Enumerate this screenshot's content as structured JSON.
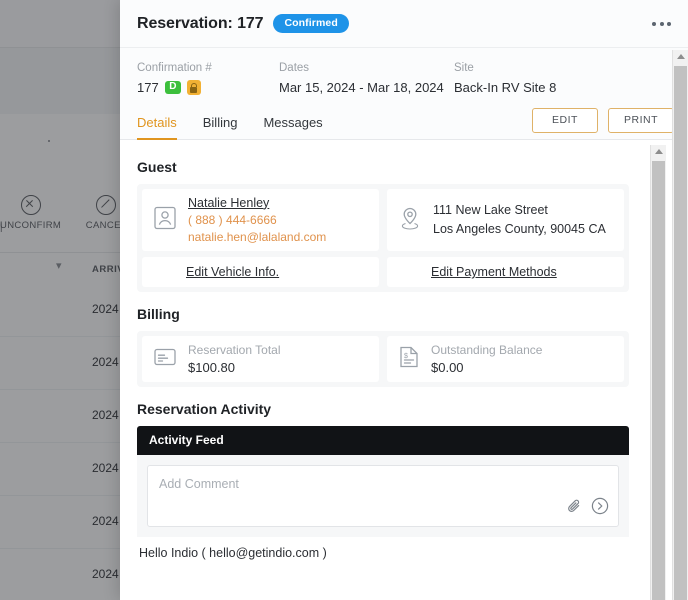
{
  "background": {
    "actions": [
      {
        "label": "UNCONFIRM",
        "icon": "circle-x-icon"
      },
      {
        "label": "CANCEL",
        "icon": "circle-slash-icon"
      }
    ],
    "table": {
      "sort_icon": "sort-icon",
      "column_header": "ARRIV",
      "rows": [
        "2024",
        "2024",
        "2024",
        "2024",
        "2024",
        "2024"
      ]
    }
  },
  "modal": {
    "title": "Reservation: 177",
    "status": "Confirmed",
    "status_color": "#1e93e8",
    "kebab": "more-options-icon",
    "summary": [
      {
        "label": "Confirmation #",
        "value": "177",
        "badges": [
          "D",
          "lock"
        ]
      },
      {
        "label": "Dates",
        "value": "Mar 15, 2024 - Mar 18, 2024"
      },
      {
        "label": "Site",
        "value": "Back-In RV Site 8"
      }
    ],
    "tabs": [
      {
        "label": "Details",
        "active": true
      },
      {
        "label": "Billing",
        "active": false
      },
      {
        "label": "Messages",
        "active": false
      }
    ],
    "tab_actions": [
      {
        "label": "EDIT"
      },
      {
        "label": "PRINT"
      }
    ],
    "accent_color": "#e0951f"
  },
  "guest": {
    "section_title": "Guest",
    "name": "Natalie Henley",
    "phone": "( 888 ) 444-6666",
    "email": "natalie.hen@lalaland.com",
    "address_line1": "111 New Lake Street",
    "address_line2": "Los Angeles County, 90045 CA",
    "person_icon": "person-card-icon",
    "location_icon": "map-pin-icon",
    "edit_vehicle_link": "Edit Vehicle Info.",
    "edit_payment_link": "Edit Payment Methods"
  },
  "billing": {
    "section_title": "Billing",
    "items": [
      {
        "label": "Reservation Total",
        "value": "$100.80",
        "icon": "credit-card-icon"
      },
      {
        "label": "Outstanding Balance",
        "value": "$0.00",
        "icon": "invoice-icon"
      }
    ]
  },
  "activity": {
    "section_title": "Reservation Activity",
    "feed_header": "Activity Feed",
    "comment_placeholder": "Add Comment",
    "attach_icon": "paperclip-icon",
    "send_icon": "send-arrow-icon",
    "entries": [
      {
        "title": "Hello Indio ( hello@getindio.com )"
      }
    ]
  }
}
